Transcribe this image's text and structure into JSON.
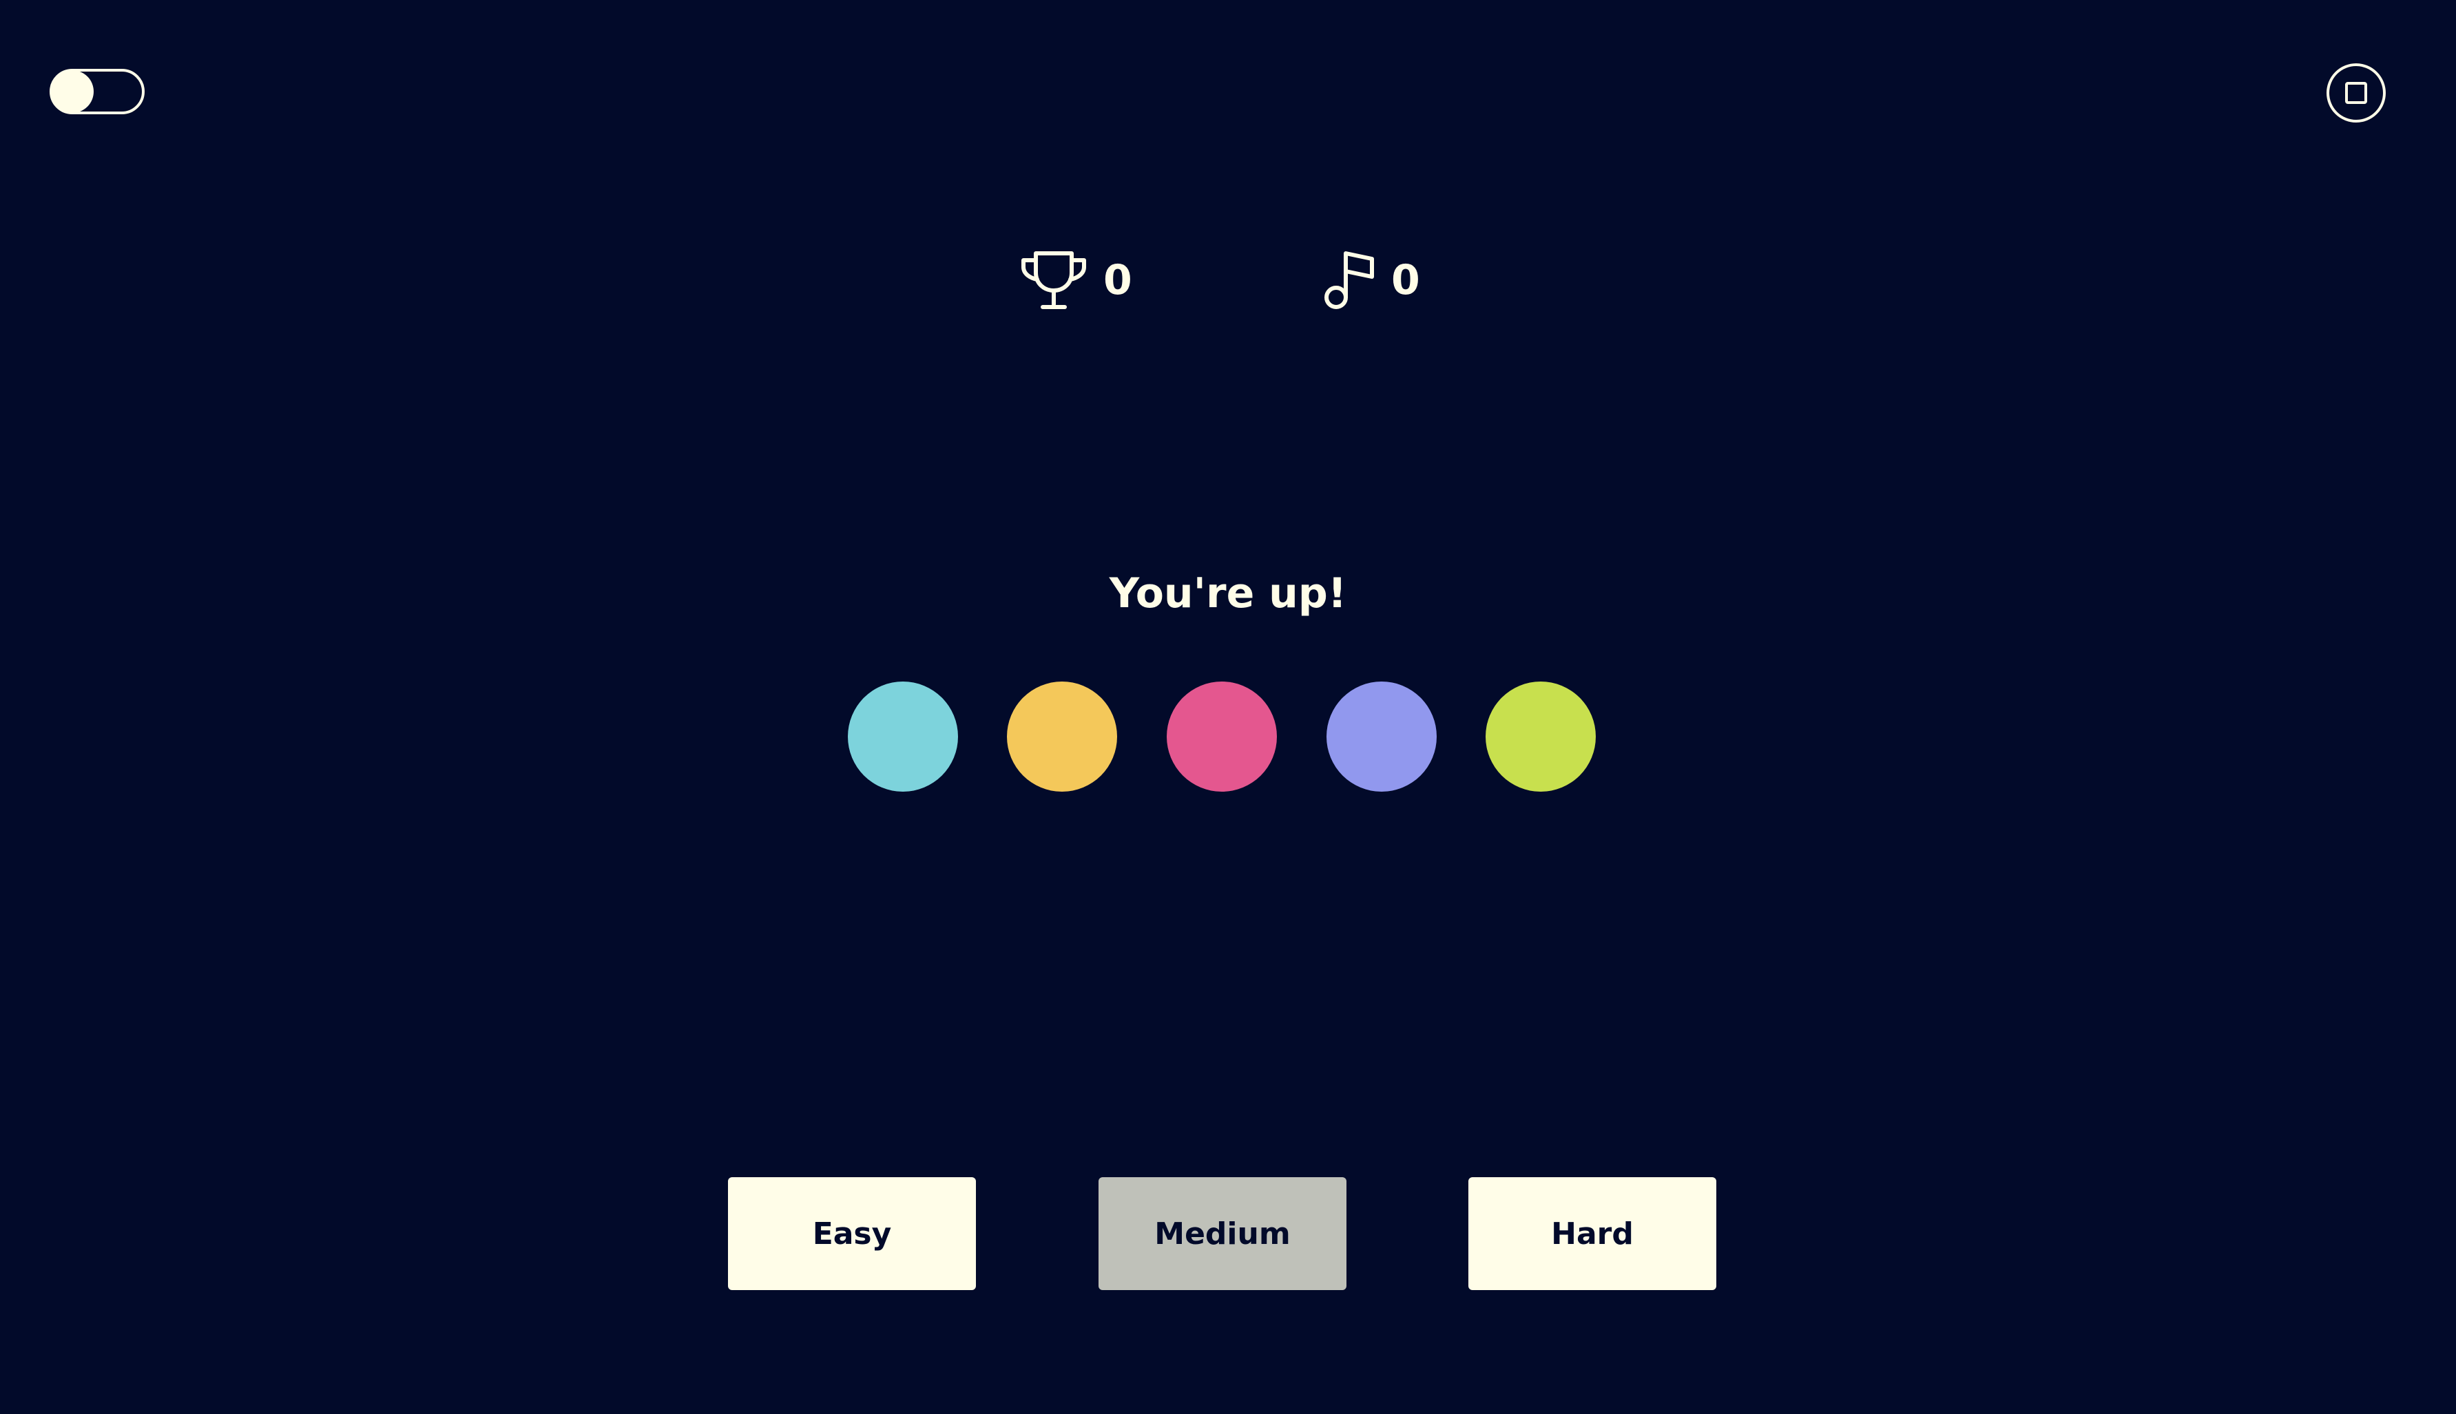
{
  "controls": {
    "toggle_state": "off",
    "stop_icon": "stop-icon"
  },
  "stats": {
    "score": {
      "icon": "trophy-icon",
      "value": "0"
    },
    "notes": {
      "icon": "music-note-icon",
      "value": "0"
    }
  },
  "status": "You're up!",
  "pads": [
    {
      "name": "cyan",
      "color": "#7dd3dc"
    },
    {
      "name": "yellow",
      "color": "#f4c85a"
    },
    {
      "name": "pink",
      "color": "#e4578f"
    },
    {
      "name": "purple",
      "color": "#9198ee"
    },
    {
      "name": "lime",
      "color": "#c8e04e"
    }
  ],
  "difficulty": {
    "selected": "Medium",
    "options": [
      {
        "label": "Easy",
        "color": "#fffde8"
      },
      {
        "label": "Medium",
        "color": "#bfc1b9"
      },
      {
        "label": "Hard",
        "color": "#fffde8"
      }
    ]
  },
  "colors": {
    "background": "#020a2a",
    "foreground": "#fffde8"
  }
}
